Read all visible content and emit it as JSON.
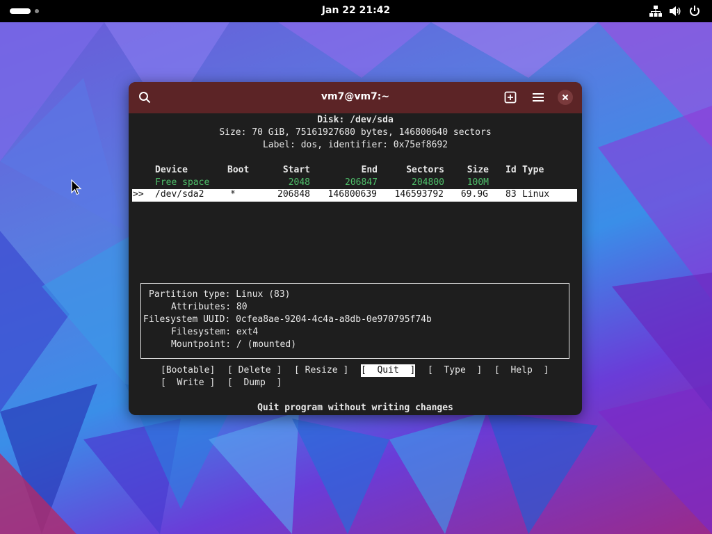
{
  "topbar": {
    "clock": "Jan 22  21:42",
    "icons": [
      "network-icon",
      "volume-icon",
      "power-icon"
    ]
  },
  "window": {
    "title": "vm7@vm7:~",
    "buttons": [
      "search-icon",
      "new-tab-icon",
      "menu-icon",
      "close-icon"
    ]
  },
  "disk": {
    "heading": "Disk: /dev/sda",
    "size_line": "Size: 70 GiB, 75161927680 bytes, 146800640 sectors",
    "label_line": "Label: dos, identifier: 0x75ef8692"
  },
  "table": {
    "headers": {
      "device": "Device",
      "boot": "Boot",
      "start": "Start",
      "end": "End",
      "sectors": "Sectors",
      "size": "Size",
      "id": "Id",
      "type": "Type"
    },
    "rows": [
      {
        "marker": "",
        "device": "Free space",
        "boot": "",
        "start": "2048",
        "end": "206847",
        "sectors": "204800",
        "size": "100M",
        "id": "",
        "type": ""
      },
      {
        "marker": ">>",
        "device": "/dev/sda2",
        "boot": "*",
        "start": "206848",
        "end": "146800639",
        "sectors": "146593792",
        "size": "69.9G",
        "id": "83",
        "type": "Linux"
      }
    ]
  },
  "info": {
    "partition_type_label": "Partition type:",
    "partition_type_value": "Linux (83)",
    "attributes_label": "Attributes:",
    "attributes_value": "80",
    "uuid_label": "Filesystem UUID:",
    "uuid_value": "0cfea8ae-9204-4c4a-a8db-0e970795f74b",
    "filesystem_label": "Filesystem:",
    "filesystem_value": "ext4",
    "mountpoint_label": "Mountpoint:",
    "mountpoint_value": "/ (mounted)"
  },
  "menu": {
    "bootable": "[Bootable]",
    "delete": "[ Delete ]",
    "resize": "[ Resize ]",
    "quit": "[  Quit  ]",
    "type": "[  Type  ]",
    "help": "[  Help  ]",
    "write": "[  Write ]",
    "dump": "[  Dump  ]",
    "selected": "quit"
  },
  "status": "Quit program without writing changes"
}
